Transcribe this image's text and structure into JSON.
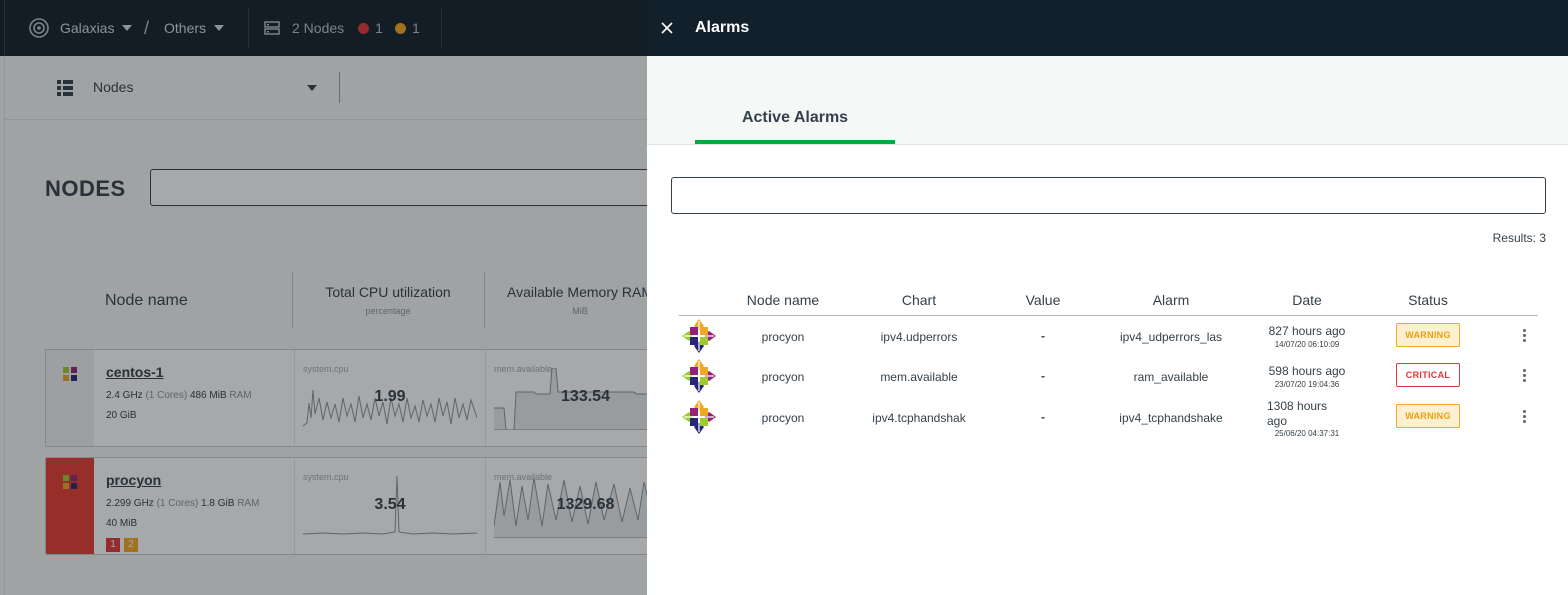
{
  "topbar": {
    "space": "Galaxias",
    "room": "Others",
    "nodes_label": "2 Nodes",
    "critical_count": "1",
    "warning_count": "1"
  },
  "view": {
    "selector_label": "Nodes"
  },
  "nodes_page": {
    "title": "NODES",
    "columns": [
      {
        "title": "Node name",
        "unit": ""
      },
      {
        "title": "Total CPU utilization",
        "unit": "percentage"
      },
      {
        "title": "Available Memory RAM",
        "unit": "MiB"
      }
    ],
    "nodes": [
      {
        "name": "centos-1",
        "cpu_freq": "2.4 GHz",
        "cores": "(1 Cores)",
        "ram": "486 MiB",
        "ram_label": "RAM",
        "disk": "20 GiB",
        "cpu_chart": "system.cpu",
        "cpu_value": "1.99",
        "mem_chart": "mem.available",
        "mem_value": "133.54",
        "alerts": []
      },
      {
        "name": "procyon",
        "cpu_freq": "2.299 GHz",
        "cores": "(1 Cores)",
        "ram": "1.8 GiB",
        "ram_label": "RAM",
        "disk": "40 MiB",
        "cpu_chart": "system.cpu",
        "cpu_value": "3.54",
        "mem_chart": "mem.available",
        "mem_value": "1329.68",
        "alerts": [
          "1",
          "2"
        ]
      }
    ]
  },
  "alarms": {
    "title": "Alarms",
    "tab_active": "Active Alarms",
    "search_value": "",
    "results": "Results: 3",
    "headers": {
      "node": "Node name",
      "chart": "Chart",
      "value": "Value",
      "alarm": "Alarm",
      "date": "Date",
      "status": "Status"
    },
    "rows": [
      {
        "node": "procyon",
        "chart": "ipv4.udperrors",
        "value": "-",
        "alarm": "ipv4_udperrors_las",
        "date": "827 hours ago",
        "date_exact": "14/07/20 06:10:09",
        "status": "WARNING",
        "status_color": "#e8a112"
      },
      {
        "node": "procyon",
        "chart": "mem.available",
        "value": "-",
        "alarm": "ram_available",
        "date": "598 hours ago",
        "date_exact": "23/07/20 19:04:36",
        "status": "CRITICAL",
        "status_color": "#e2363b"
      },
      {
        "node": "procyon",
        "chart": "ipv4.tcphandshak",
        "value": "-",
        "alarm": "ipv4_tcphandshake",
        "date_line1": "1308 hours",
        "date_line2": "ago",
        "date_exact": "25/06/20 04:37:31",
        "status": "WARNING",
        "status_color": "#e8a112"
      }
    ]
  },
  "colors": {
    "brand_green": "#00ab44",
    "header_dark": "#12202b",
    "critical": "#e2363b",
    "warning": "#f5a623"
  }
}
